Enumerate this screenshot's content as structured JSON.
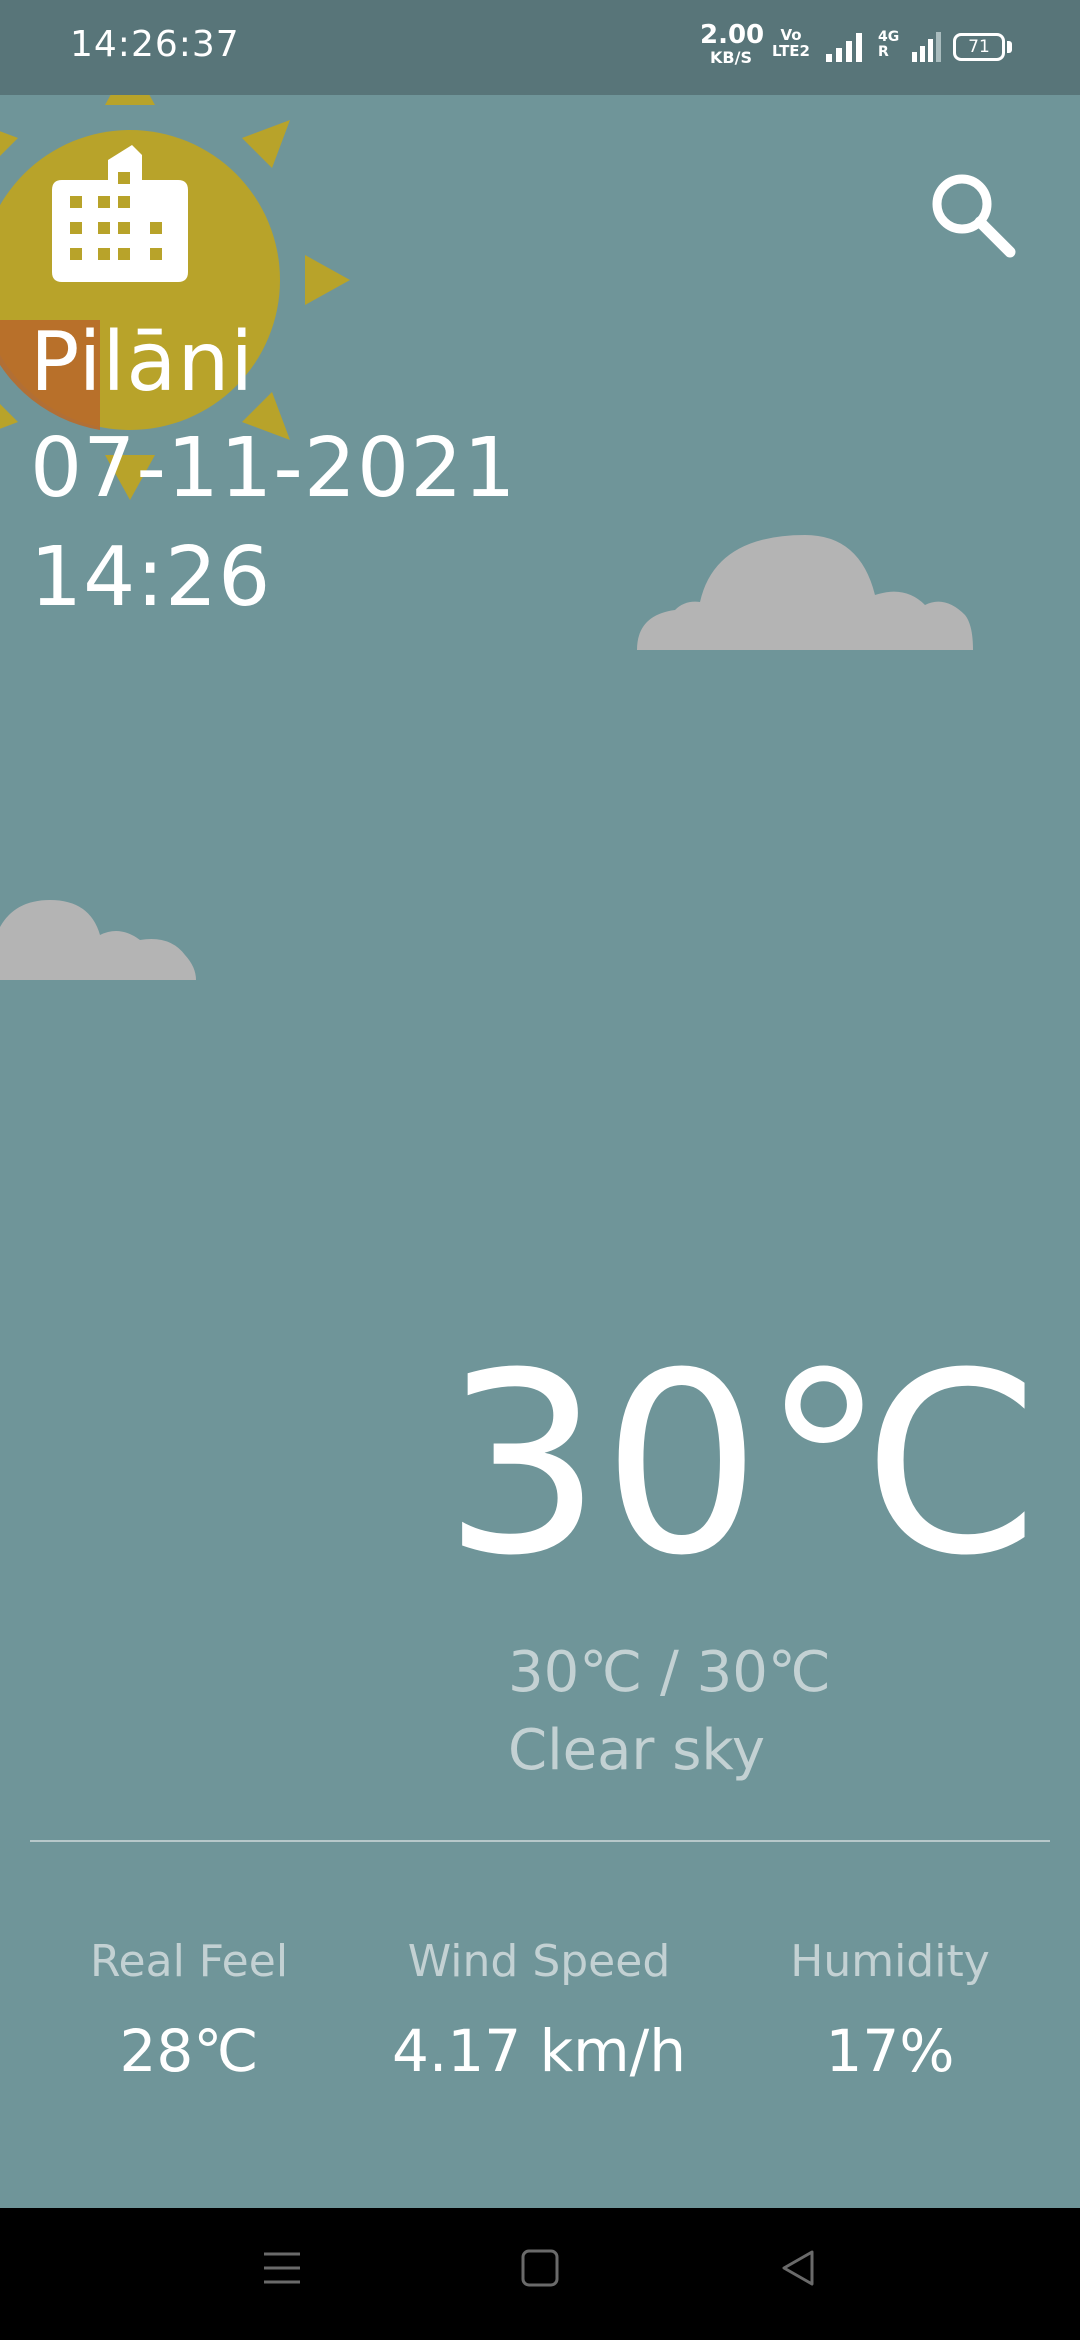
{
  "status_bar": {
    "time": "14:26:37",
    "speed_value": "2.00",
    "speed_unit": "KB/S",
    "volte_top": "Vo",
    "volte_bottom": "LTE2",
    "network_top": "4G",
    "network_bottom": "R",
    "battery": "71"
  },
  "location": {
    "city": "Pilāni",
    "date": "07-11-2021",
    "time": "14:26"
  },
  "weather": {
    "temperature": "30℃",
    "range": "30℃ / 30℃",
    "condition": "Clear sky"
  },
  "stats": {
    "real_feel_label": "Real Feel",
    "real_feel_value": "28℃",
    "wind_label": "Wind Speed",
    "wind_value": "4.17 km/h",
    "humidity_label": "Humidity",
    "humidity_value": "17%"
  },
  "colors": {
    "background": "#6f9599",
    "status_bar": "#587579",
    "sun": "#b8a32a",
    "sun_inner": "#b86a2a",
    "cloud": "#b4b4b4",
    "nav_bar": "#000000"
  },
  "icons": {
    "building": "building-icon",
    "search": "search-icon",
    "nav_menu": "menu-icon",
    "nav_home": "home-icon",
    "nav_back": "back-icon"
  }
}
